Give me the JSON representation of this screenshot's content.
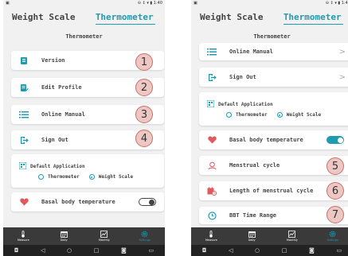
{
  "status": {
    "right": "⊖ ↕ ▾ ▮ 1:40"
  },
  "tabs": [
    "Weight Scale",
    "Thermometer"
  ],
  "page_title": "Thermometer",
  "colors": {
    "accent": "#1f9bb0",
    "heart": "#e0595f",
    "badge_fill": "#ecc7c3",
    "badge_border": "#cc6f63",
    "navbar": "#3a3a3a"
  },
  "left": {
    "items": [
      {
        "label": "Version",
        "icon": "device-info-icon",
        "badge": "1"
      },
      {
        "label": "Edit Profile",
        "icon": "edit-profile-icon",
        "badge": "2"
      },
      {
        "label": "Online Manual",
        "icon": "list-icon",
        "badge": "3"
      },
      {
        "label": "Sign Out",
        "icon": "sign-out-icon",
        "badge": "4"
      }
    ],
    "default_app": {
      "label": "Default Application",
      "options": [
        "Thermometer",
        "Weight Scale"
      ],
      "selected": "Weight Scale"
    },
    "basal": {
      "label": "Basal body temperature",
      "toggle": false
    }
  },
  "right": {
    "items_top": [
      {
        "label": "Online Manual",
        "icon": "list-icon"
      },
      {
        "label": "Sign Out",
        "icon": "sign-out-icon"
      }
    ],
    "default_app": {
      "label": "Default Application",
      "options": [
        "Thermometer",
        "Weight Scale"
      ],
      "selected": "Weight Scale"
    },
    "basal": {
      "label": "Basal body temperature",
      "toggle": true
    },
    "items_bottom": [
      {
        "label": "Menstrual cycle",
        "icon": "menstrual-cycle-icon",
        "badge": "5"
      },
      {
        "label": "Length of menstrual cycle",
        "icon": "calendar-clock-icon",
        "badge": "6"
      },
      {
        "label": "BBT Time Range",
        "icon": "clock-icon",
        "badge": "7"
      }
    ]
  },
  "nav": [
    "Measure",
    "Daily",
    "Monthly",
    "Settings"
  ]
}
